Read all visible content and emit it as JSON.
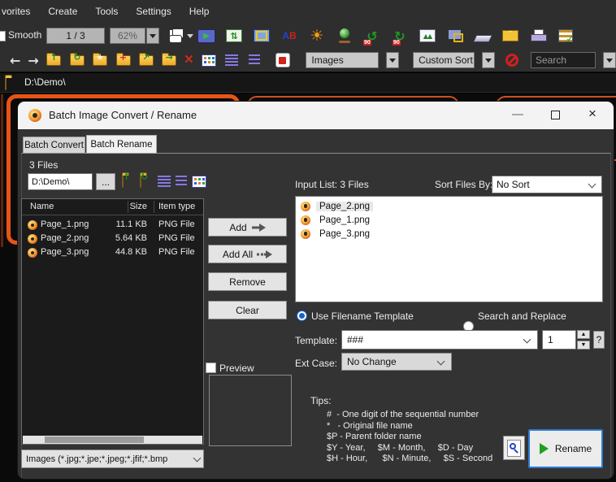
{
  "menu": {
    "items": [
      "vorites",
      "Create",
      "Tools",
      "Settings",
      "Help"
    ]
  },
  "toolbar": {
    "smooth_label": "Smooth",
    "page_indicator": "1 / 3",
    "zoom_level": "62%"
  },
  "nav_toolbar": {
    "filter_value": "Images",
    "sort_value": "Custom Sort",
    "search_placeholder": "Search"
  },
  "address_bar": {
    "path": "D:\\Demo\\"
  },
  "icons": {
    "back": "←",
    "forward": "→",
    "folder_up": "↑",
    "folder_refresh": "↻",
    "folder_star": "★",
    "folder_new": "+",
    "move": "↗",
    "copy": "→",
    "delete": "×",
    "sun": "☀",
    "rotate_left": "↺",
    "rotate_right": "↻",
    "play": "▶",
    "trees": "▲▲",
    "check": "✓",
    "letter_a": "A",
    "letter_b": "B"
  },
  "dialog": {
    "title": "Batch Image Convert / Rename",
    "tabs": {
      "convert": "Batch Convert",
      "rename": "Batch Rename"
    },
    "files_count": "3 Files",
    "source": {
      "folder_path": "D:\\Demo\\",
      "browse_label": "...",
      "columns": {
        "name": "Name",
        "size": "Size",
        "type": "Item type"
      },
      "files": [
        {
          "name": "Page_1.png",
          "size": "11.1 KB",
          "type": "PNG File"
        },
        {
          "name": "Page_2.png",
          "size": "5.64 KB",
          "type": "PNG File"
        },
        {
          "name": "Page_3.png",
          "size": "44.8 KB",
          "type": "PNG File"
        }
      ],
      "filter_value": "Images (*.jpg;*.jpe;*.jpeg;*.jfif;*.bmp"
    },
    "actions": {
      "add": "Add",
      "add_all": "Add All",
      "remove": "Remove",
      "clear": "Clear"
    },
    "preview_label": "Preview",
    "input_list": {
      "label": "Input List:  3 Files",
      "sort_label": "Sort Files By:",
      "sort_value": "No Sort",
      "items": [
        "Page_2.png",
        "Page_1.png",
        "Page_3.png"
      ]
    },
    "rename_options": {
      "radio_template": "Use Filename Template",
      "radio_search": "Search and Replace",
      "template_label": "Template:",
      "template_value": "###",
      "start_number": "1",
      "help_label": "?",
      "ext_case_label": "Ext Case:",
      "ext_case_value": "No Change"
    },
    "tips": {
      "title": "Tips:",
      "line1": "#  - One digit of the sequential number",
      "line2": "*   - Original file name",
      "line3": "$P - Parent folder name",
      "line4": "$Y - Year,     $M - Month,     $D - Day",
      "line5": "$H - Hour,      $N - Minute,     $S - Second"
    },
    "rename_button": "Rename"
  },
  "colors": {
    "accent_orange": "#e65419",
    "focus_blue": "#2e7cd6",
    "run_green": "#1fa11f"
  }
}
